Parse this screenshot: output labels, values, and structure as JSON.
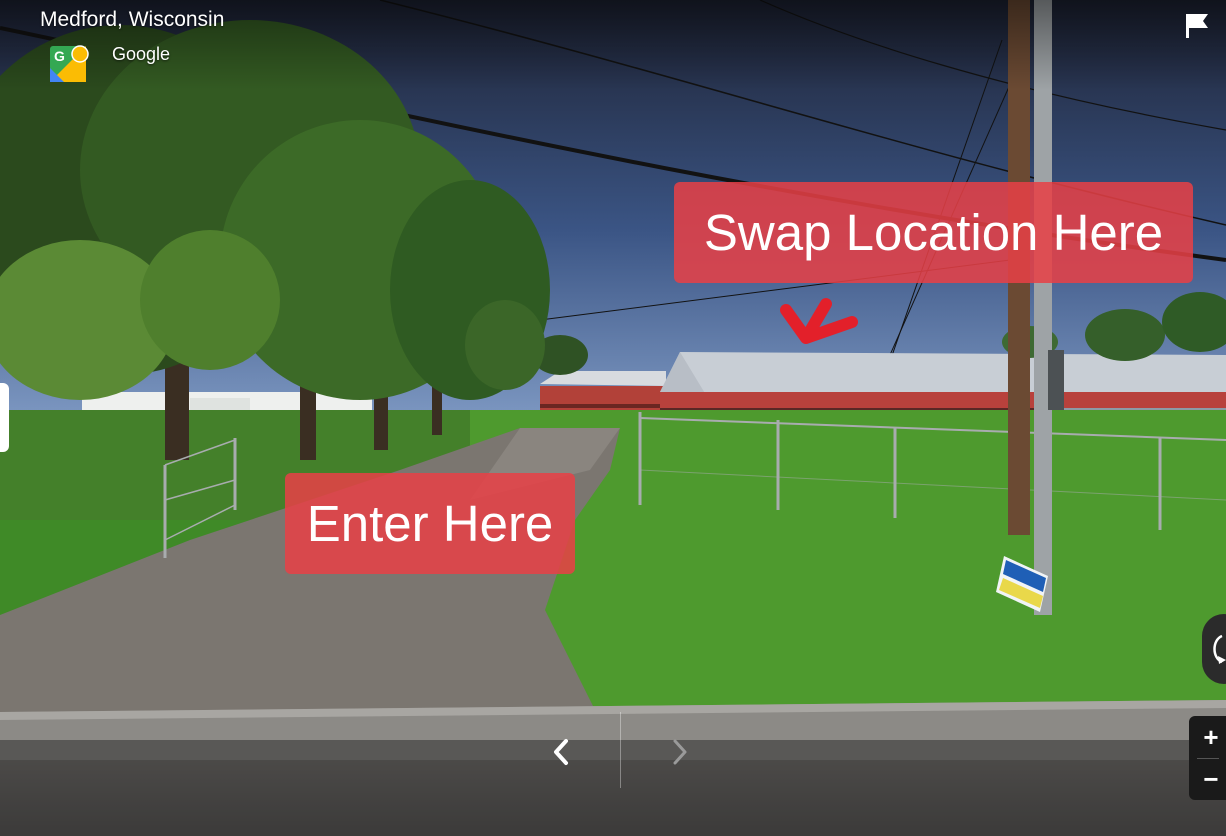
{
  "location": {
    "title": "Medford, Wisconsin",
    "provider": "Google"
  },
  "annotations": {
    "swap_text": "Swap Location Here",
    "enter_text": "Enter Here"
  },
  "controls": {
    "zoom_in": "+",
    "zoom_out": "−"
  },
  "icons": {
    "logo": "street-view-logo-icon",
    "flag": "flag-icon",
    "compass": "compass-icon",
    "prev": "chevron-left-icon",
    "next": "chevron-right-icon",
    "arrow": "red-arrow-icon"
  },
  "colors": {
    "annotation": "#e84046",
    "barn_red": "#b8413c",
    "roof": "#c9ced4",
    "grass": "#4e9a2e",
    "sky": "#2d3f63"
  }
}
